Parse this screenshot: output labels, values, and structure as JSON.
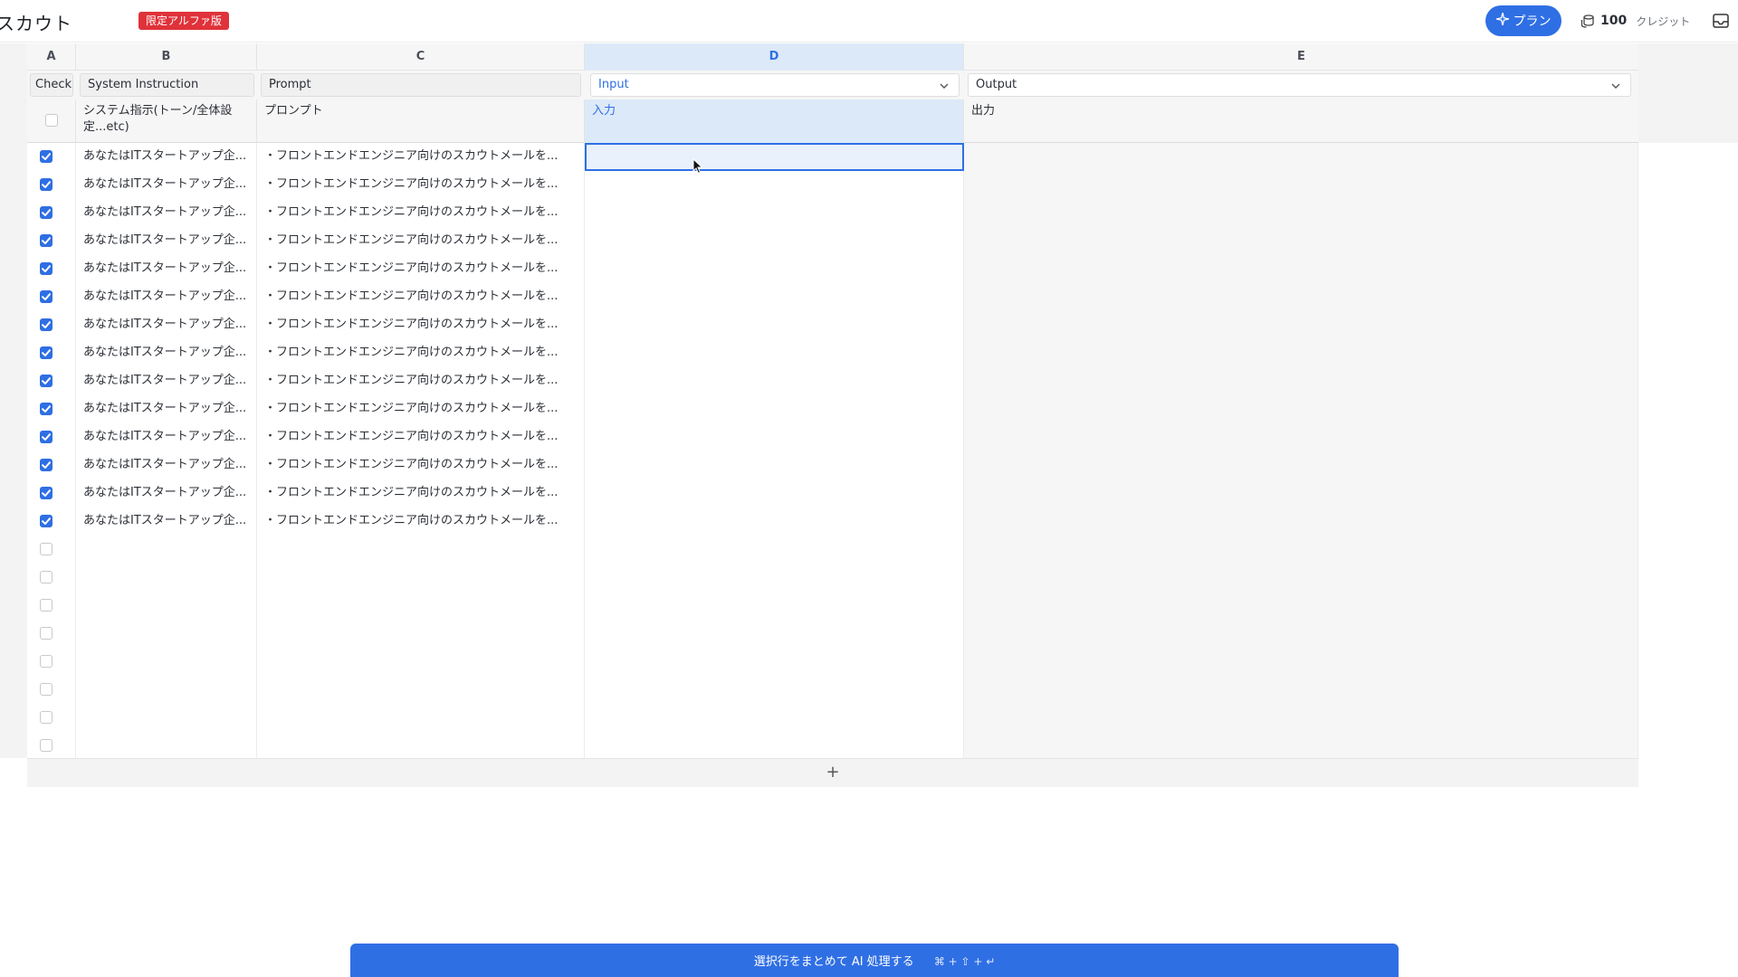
{
  "header": {
    "app_title": "スカウト",
    "alpha_badge": "限定アルファ版",
    "plan_label": "プラン",
    "credits_amount": "100",
    "credits_unit": "クレジット",
    "accent_color": "#2f6fe4",
    "badge_color": "#e0323a"
  },
  "columns": {
    "letters": [
      "A",
      "B",
      "C",
      "D",
      "E"
    ],
    "selected_letter": "D",
    "fields": {
      "a": "Check",
      "b": "System Instruction",
      "c": "Prompt",
      "d": "Input",
      "e": "Output"
    },
    "descriptions": {
      "b": "システム指示(トーン/全体設定...etc)",
      "c": "プロンプト",
      "d": "入力",
      "e": "出力"
    }
  },
  "rows": {
    "filled_count": 14,
    "empty_count": 8,
    "system_instruction": "あなたはITスタートアップ企...",
    "prompt": "・フロントエンドエンジニア向けのスカウトメールを..."
  },
  "add_row_label": "+",
  "process_button": {
    "label": "選択行をまとめて AI 処理する",
    "shortcut": "⌘ + ⇧ + ↵"
  },
  "icons": [
    "sparkle-icon",
    "coin-stack-icon",
    "inbox-icon",
    "chevron-down-icon",
    "checkbox-checked-icon",
    "mouse-cursor-icon"
  ]
}
